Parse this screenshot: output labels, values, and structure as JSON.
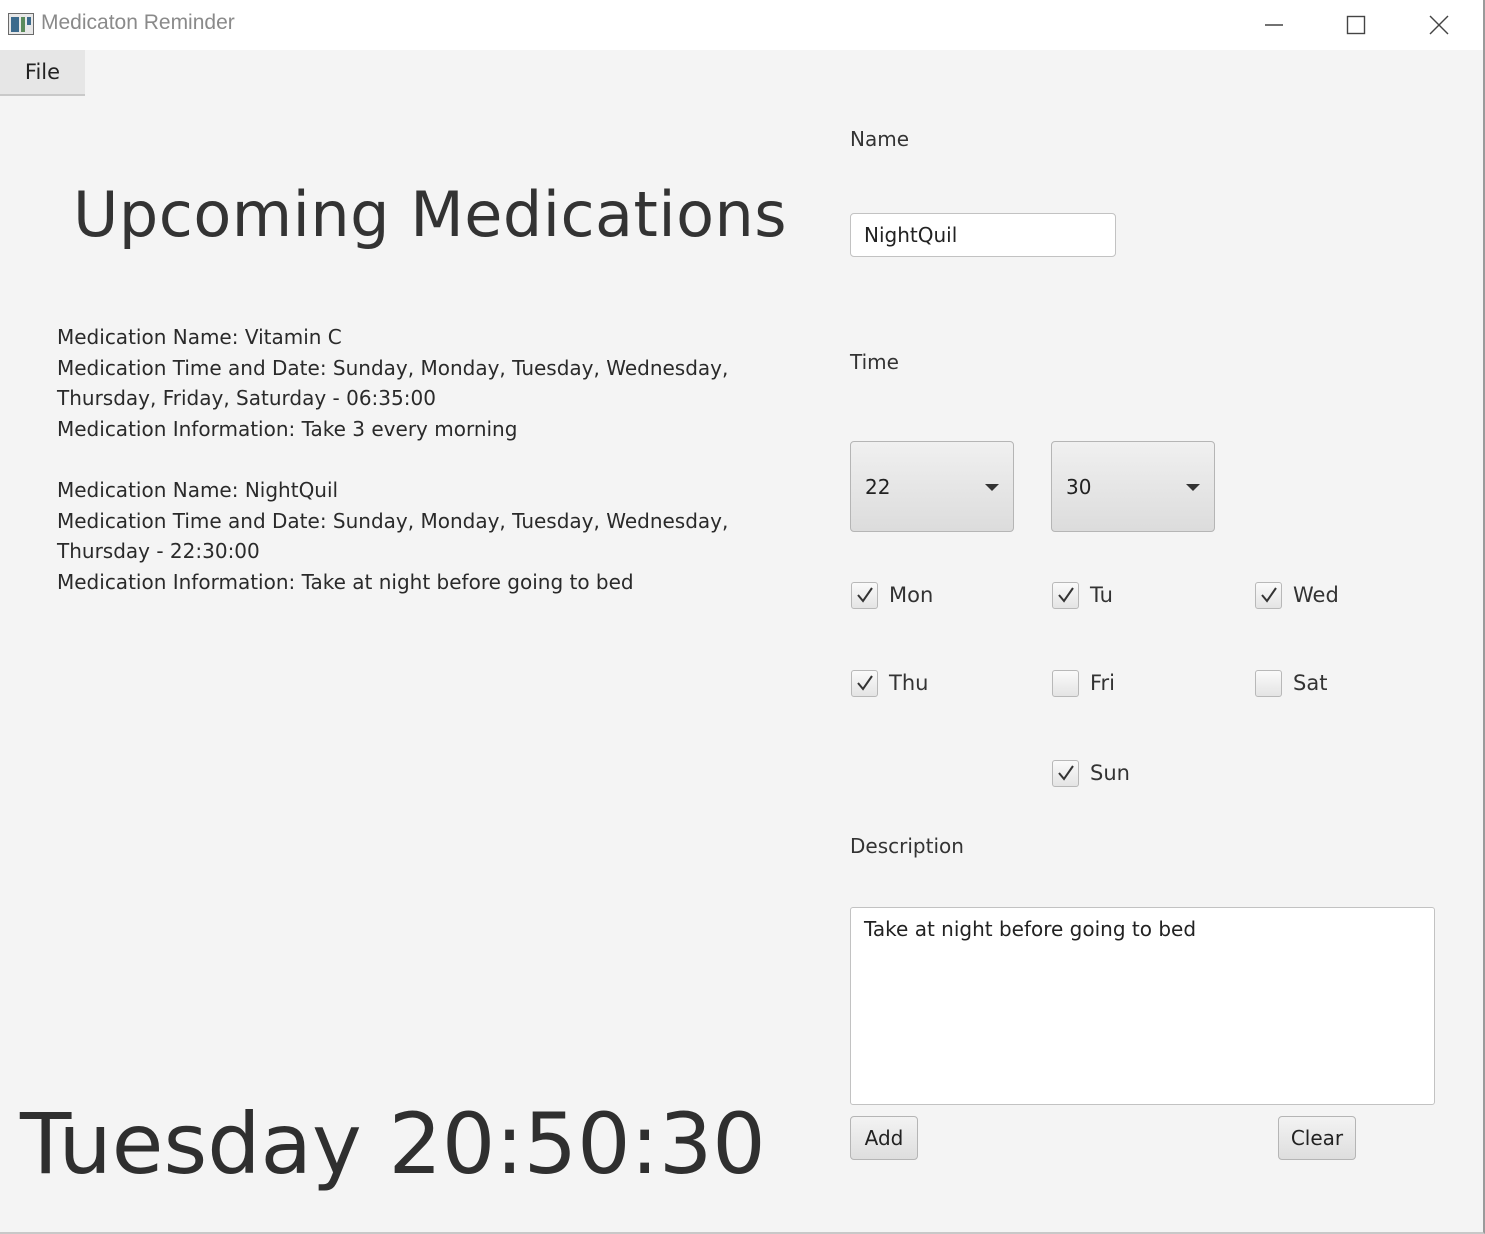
{
  "window": {
    "title": "Medicaton Reminder",
    "minimize_icon": "minimize-icon",
    "maximize_icon": "maximize-icon",
    "close_icon": "close-icon"
  },
  "menu": {
    "file_label": "File"
  },
  "left": {
    "heading": "Upcoming Medications",
    "medications": [
      {
        "name_line": "Medication Name: Vitamin C",
        "time_line": "Medication Time and Date: Sunday, Monday, Tuesday, Wednesday, Thursday, Friday, Saturday - 06:35:00",
        "info_line": "Medication Information: Take 3 every morning"
      },
      {
        "name_line": "Medication Name: NightQuil",
        "time_line": "Medication Time and Date: Sunday, Monday, Tuesday, Wednesday, Thursday - 22:30:00",
        "info_line": "Medication Information: Take at night before going to bed"
      }
    ],
    "clock": "Tuesday 20:50:30"
  },
  "form": {
    "name_label": "Name",
    "name_value": "NightQuil",
    "time_label": "Time",
    "hour_value": "22",
    "minute_value": "30",
    "days": {
      "mon": {
        "label": "Mon",
        "checked": true
      },
      "tu": {
        "label": "Tu",
        "checked": true
      },
      "wed": {
        "label": "Wed",
        "checked": true
      },
      "thu": {
        "label": "Thu",
        "checked": true
      },
      "fri": {
        "label": "Fri",
        "checked": false
      },
      "sat": {
        "label": "Sat",
        "checked": false
      },
      "sun": {
        "label": "Sun",
        "checked": true
      }
    },
    "description_label": "Description",
    "description_value": "Take at night before going to bed",
    "add_label": "Add",
    "clear_label": "Clear"
  }
}
